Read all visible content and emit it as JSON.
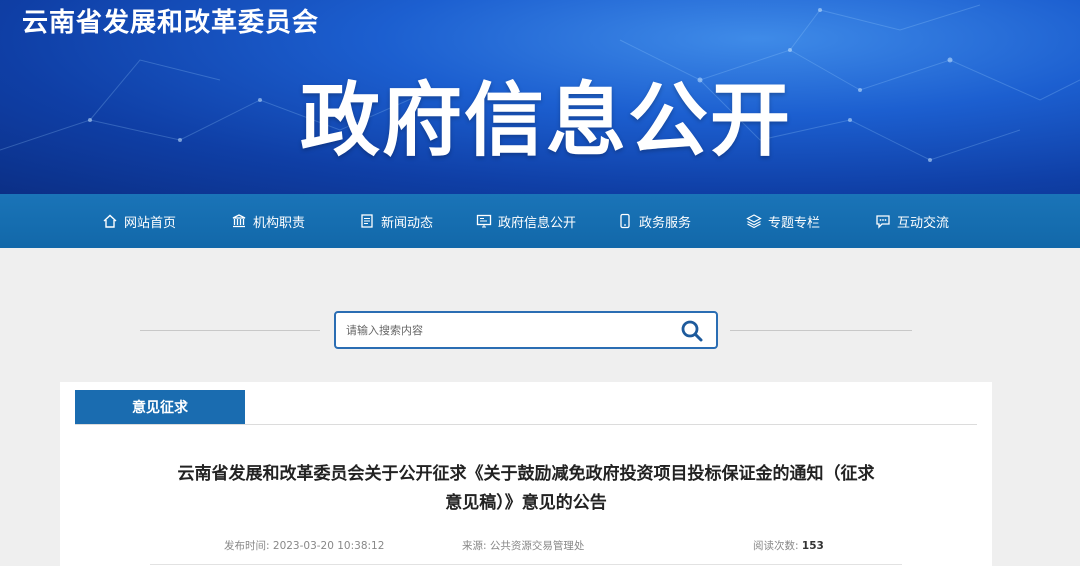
{
  "header": {
    "org_name": "云南省发展和改革委员会",
    "site_title": "政府信息公开",
    "colors": {
      "banner": "#1c5fd0",
      "nav": "#1a74b8"
    }
  },
  "nav": {
    "items": [
      {
        "label": "网站首页",
        "icon": "home-icon"
      },
      {
        "label": "机构职责",
        "icon": "building-icon"
      },
      {
        "label": "新闻动态",
        "icon": "document-icon"
      },
      {
        "label": "政府信息公开",
        "icon": "screen-icon"
      },
      {
        "label": "政务服务",
        "icon": "phone-icon"
      },
      {
        "label": "专题专栏",
        "icon": "layers-icon"
      },
      {
        "label": "互动交流",
        "icon": "chat-icon"
      }
    ]
  },
  "search": {
    "placeholder": "请输入搜索内容",
    "icon": "search-icon"
  },
  "content": {
    "section_label": "意见征求",
    "title_line1": "云南省发展和改革委员会关于公开征求《关于鼓励减免政府投资项目投标保证金的通知（征求",
    "title_line2": "意见稿）》意见的公告",
    "meta": {
      "publish_label": "发布时间:",
      "publish_value": "2023-03-20 10:38:12",
      "source_label": "来源:",
      "source_value": "公共资源交易管理处",
      "views_label": "阅读次数:",
      "views_value": "153"
    }
  }
}
